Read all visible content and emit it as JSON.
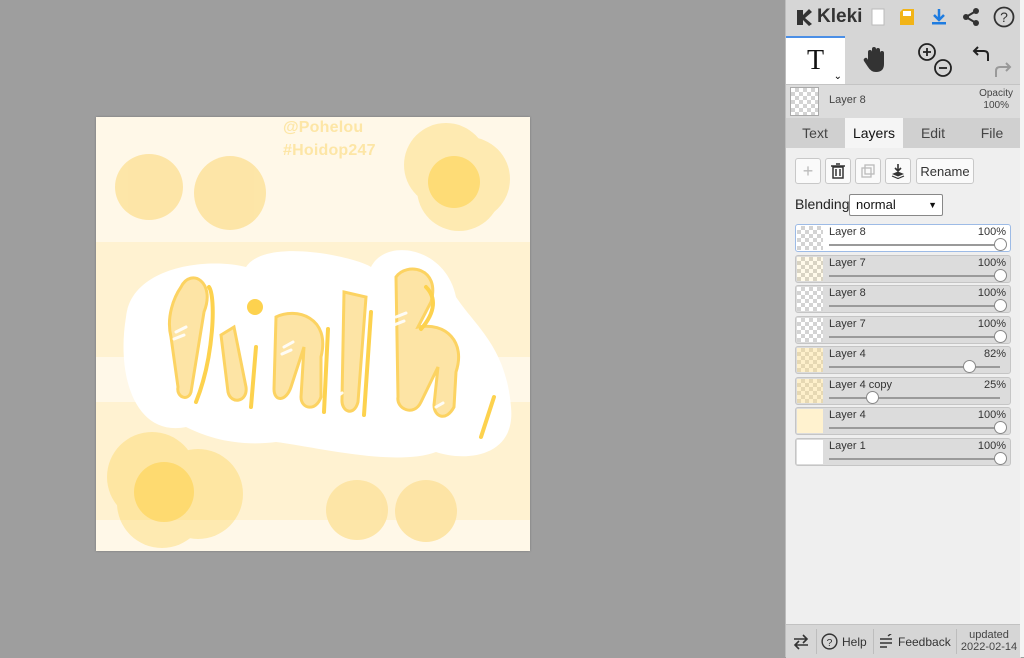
{
  "app": {
    "name": "Kleki"
  },
  "canvas": {
    "watermark_line1": "@Pohelou",
    "watermark_line2": "#Hoidop247",
    "artwork_text": "linh",
    "colors": {
      "background": "#fff8e8",
      "accent": "#fdd24e",
      "soft": "#fde3a1"
    }
  },
  "topbar": {
    "icons": [
      "new-file-icon",
      "save-icon",
      "download-icon",
      "share-icon",
      "help-icon"
    ]
  },
  "toolbar": {
    "tools": [
      "text-tool",
      "hand-tool",
      "zoom-in",
      "zoom-out",
      "undo",
      "redo"
    ],
    "active_tool": "T"
  },
  "current_layer": {
    "name": "Layer 8",
    "opacity_label": "Opacity",
    "opacity_value": "100%"
  },
  "tabs": [
    {
      "label": "Text",
      "active": false
    },
    {
      "label": "Layers",
      "active": true
    },
    {
      "label": "Edit",
      "active": false
    },
    {
      "label": "File",
      "active": false
    }
  ],
  "layer_actions": {
    "rename_label": "Rename"
  },
  "blending": {
    "label": "Blending",
    "value": "normal"
  },
  "layers": [
    {
      "name": "Layer 8",
      "opacity": "100%",
      "value": 1.0,
      "selected": true,
      "thumb": "checker"
    },
    {
      "name": "Layer 7",
      "opacity": "100%",
      "value": 1.0,
      "selected": false,
      "thumb": "checker-dots"
    },
    {
      "name": "Layer 8",
      "opacity": "100%",
      "value": 1.0,
      "selected": false,
      "thumb": "checker"
    },
    {
      "name": "Layer 7",
      "opacity": "100%",
      "value": 1.0,
      "selected": false,
      "thumb": "checker"
    },
    {
      "name": "Layer 4",
      "opacity": "82%",
      "value": 0.82,
      "selected": false,
      "thumb": "checker-yellow"
    },
    {
      "name": "Layer 4 copy",
      "opacity": "25%",
      "value": 0.25,
      "selected": false,
      "thumb": "checker-yellow"
    },
    {
      "name": "Layer 4",
      "opacity": "100%",
      "value": 1.0,
      "selected": false,
      "thumb": "cream"
    },
    {
      "name": "Layer 1",
      "opacity": "100%",
      "value": 1.0,
      "selected": false,
      "thumb": "white"
    }
  ],
  "footer": {
    "help_label": "Help",
    "feedback_label": "Feedback",
    "updated_label": "updated",
    "updated_date": "2022-02-14"
  }
}
